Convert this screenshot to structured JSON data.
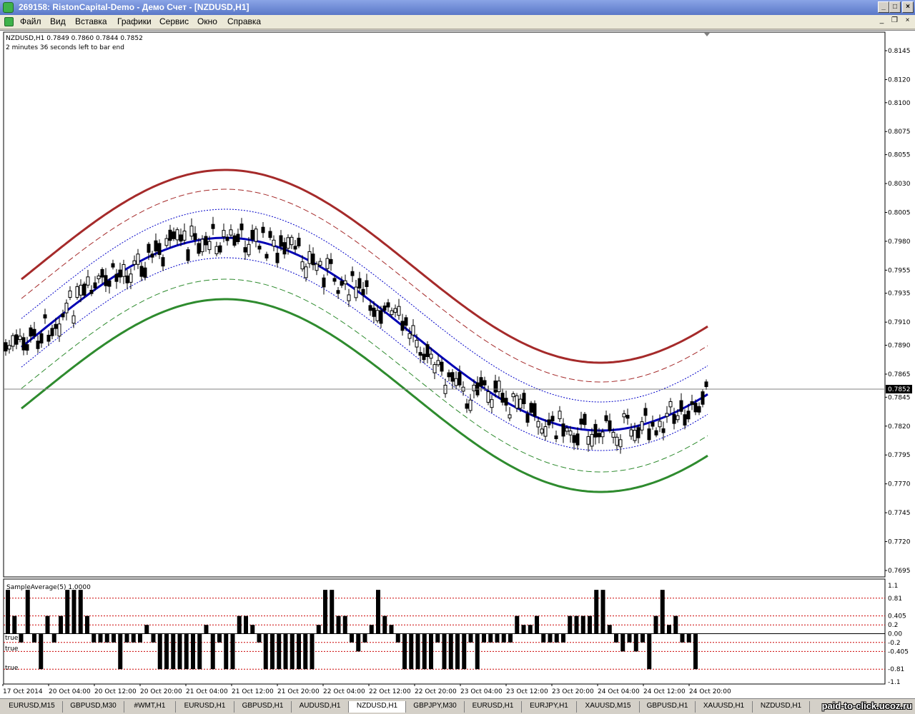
{
  "window": {
    "title": "269158: RistonCapital-Demo - Демо Счет - [NZDUSD,H1]"
  },
  "menu": {
    "items": [
      "Файл",
      "Вид",
      "Вставка",
      "Графики",
      "Сервис",
      "Окно",
      "Справка"
    ]
  },
  "chart": {
    "symbol_line": "NZDUSD,H1  0.7849 0.7860 0.7844 0.7852",
    "timer_line": "2 minutes 36 seconds left to bar end",
    "current_price_label": "0.7852",
    "price_ticks": [
      "0.8145",
      "0.8120",
      "0.8100",
      "0.8075",
      "0.8055",
      "0.8030",
      "0.8005",
      "0.7980",
      "0.7955",
      "0.7935",
      "0.7910",
      "0.7890",
      "0.7865",
      "0.7845",
      "0.7820",
      "0.7795",
      "0.7770",
      "0.7745",
      "0.7720",
      "0.7695"
    ],
    "time_ticks": [
      "17 Oct 2014",
      "20 Oct 04:00",
      "20 Oct 12:00",
      "20 Oct 20:00",
      "21 Oct 04:00",
      "21 Oct 12:00",
      "21 Oct 20:00",
      "22 Oct 04:00",
      "22 Oct 12:00",
      "22 Oct 20:00",
      "23 Oct 04:00",
      "23 Oct 12:00",
      "23 Oct 20:00",
      "24 Oct 04:00",
      "24 Oct 12:00",
      "24 Oct 20:00"
    ],
    "colors": {
      "upper_band": "#a52a2a",
      "mid_line": "#0000b4",
      "lower_band": "#2e8b2e",
      "inner_upper": "#0000c8",
      "grid": "#c0c0c0"
    }
  },
  "indicator": {
    "label": "SampleAverage(5) 1.0000",
    "ticks": [
      "1.1",
      "0.81",
      "0.405",
      "0.2",
      "0.00",
      "-0.2",
      "-0.405",
      "-0.81",
      "-1.1"
    ],
    "true_labels": [
      "true",
      "true",
      "true"
    ],
    "bar_values": [
      1,
      0.405,
      -0.2,
      1,
      -0.2,
      -0.81,
      0.405,
      -0.2,
      0.405,
      1,
      1,
      1,
      0.405,
      -0.2,
      -0.2,
      -0.2,
      -0.2,
      -0.81,
      -0.2,
      -0.2,
      -0.2,
      0.2,
      -0.2,
      -0.81,
      -0.81,
      -0.81,
      -0.81,
      -0.81,
      -0.81,
      -0.81,
      0.2,
      -0.81,
      -0.2,
      -0.81,
      -0.81,
      0.405,
      0.405,
      0.2,
      -0.2,
      -0.81,
      -0.81,
      -0.81,
      -0.81,
      -0.81,
      -0.81,
      -0.81,
      -0.81,
      0.2,
      1,
      1,
      0.405,
      0.405,
      -0.2,
      -0.405,
      -0.2,
      0.2,
      1,
      0.405,
      0.2,
      -0.2,
      -0.81,
      -0.81,
      -0.81,
      -0.81,
      -0.81,
      -0.2,
      -0.81,
      -0.81,
      -0.81,
      -0.81,
      -0.2,
      -0.81,
      -0.2,
      -0.2,
      -0.2,
      -0.2,
      -0.2,
      0.405,
      0.2,
      0.2,
      0.405,
      -0.2,
      -0.2,
      -0.2,
      -0.2,
      0.405,
      0.405,
      0.405,
      0.405,
      1,
      1,
      0.2,
      -0.2,
      -0.405,
      -0.2,
      -0.405,
      -0.2,
      -0.81,
      0.405,
      1,
      0.2,
      0.405,
      -0.2,
      -0.2,
      -0.81
    ]
  },
  "tabs": [
    "EURUSD,M15",
    "GBPUSD,M30",
    "#WMT,H1",
    "EURUSD,H1",
    "GBPUSD,H1",
    "AUDUSD,H1",
    "NZDUSD,H1",
    "GBPJPY,M30",
    "EURUSD,H1",
    "EURJPY,H1",
    "XAUUSD,M15",
    "GBPUSD,H1",
    "XAUUSD,H1",
    "NZDUSD,H1"
  ],
  "watermark": "paid-to-click.ucoz.ru"
}
